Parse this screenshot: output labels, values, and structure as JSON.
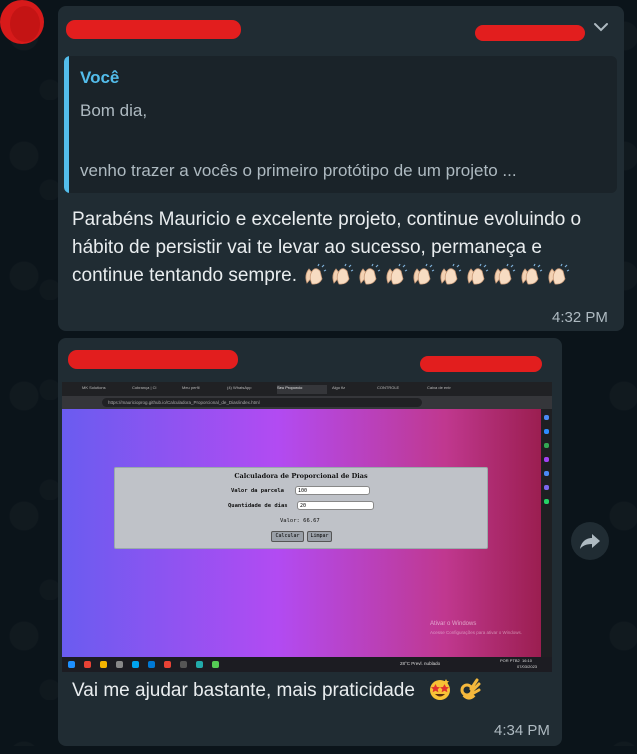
{
  "message1": {
    "quote": {
      "author": "Você",
      "line1": "Bom dia,",
      "line2": "venho trazer a vocês o primeiro protótipo de um projeto ..."
    },
    "text": "Parabéns Mauricio e excelente projeto, continue evoluindo o hábito de persistir vai te levar ao sucesso, permaneça e continue tentando sempre.",
    "emojis": [
      "clapping-hands",
      "clapping-hands",
      "clapping-hands",
      "clapping-hands",
      "clapping-hands",
      "clapping-hands",
      "clapping-hands",
      "clapping-hands",
      "clapping-hands",
      "clapping-hands"
    ],
    "time": "4:32 PM"
  },
  "message2": {
    "screenshot": {
      "tabs": [
        "MK Solutions",
        "Cobrança | Cl",
        "Meu perfil",
        "(4) WhatsApp",
        "Seu Proporcio",
        "Algo fiz",
        "CONTROLE",
        "Caixa de entr"
      ],
      "url": "https://mauricioprog.github.io/Calculadora_Proporcional_de_Dias/index.html",
      "calculator": {
        "title": "Calculadora de Proporcional de Dias",
        "parcela_label": "Valor da parcela",
        "parcela_value": "100",
        "dias_label": "Quantidade de dias",
        "dias_value": "20",
        "result": "Valor: 66.67",
        "calc_button": "Calcular",
        "clear_button": "Limpar"
      },
      "watermark_title": "Ativar o Windows",
      "watermark_sub": "Acesse Configurações para ativar o Windows.",
      "weather": "28°C Prevl. nublado",
      "clock_time": "16:10",
      "clock_date": "07/03/2023",
      "lang": "POR PTB2"
    },
    "caption": "Vai me ajudar bastante, mais praticidade",
    "emojis": [
      "star-struck",
      "ok-hand"
    ],
    "time": "4:34 PM"
  },
  "colors": {
    "background": "#0b141a",
    "bubble": "#202c33",
    "quote_accent": "#53bdeb",
    "redaction": "#e21e1e"
  }
}
